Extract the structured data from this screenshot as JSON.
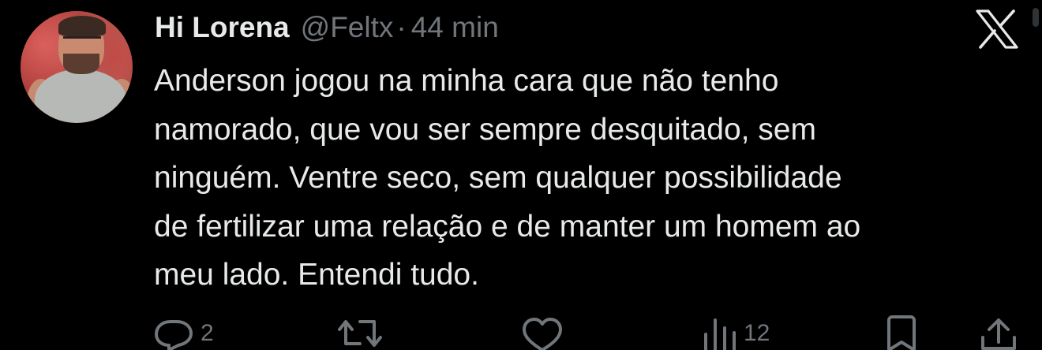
{
  "tweet": {
    "author": {
      "display_name": "Hi Lorena",
      "handle": "@Feltx",
      "separator": "·",
      "time": "44 min",
      "avatar_icon": "profile-photo"
    },
    "text_lines": [
      "Anderson jogou na minha cara que não tenho",
      "namorado, que vou ser sempre desquitado, sem",
      "ninguém. Ventre seco, sem qualquer possibilidade",
      "de fertilizar uma relação e de manter um homem ao",
      "meu lado. Entendi tudo."
    ],
    "actions": {
      "reply": {
        "icon": "reply-icon",
        "count": "2"
      },
      "retweet": {
        "icon": "retweet-icon",
        "count": ""
      },
      "like": {
        "icon": "heart-icon",
        "count": ""
      },
      "views": {
        "icon": "views-icon",
        "count": "12"
      },
      "bookmark": {
        "icon": "bookmark-icon",
        "count": ""
      },
      "share": {
        "icon": "share-icon",
        "count": ""
      }
    },
    "brand_logo": "x-logo-icon"
  },
  "colors": {
    "background": "#000000",
    "primary_text": "#e7e9ea",
    "secondary_text": "#71767b"
  }
}
